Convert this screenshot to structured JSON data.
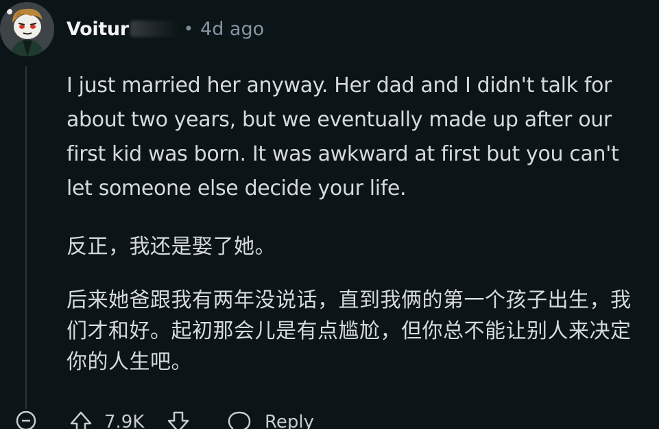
{
  "comment": {
    "author": "Voitur",
    "separator": "•",
    "timestamp": "4d ago",
    "paragraphs_en": [
      "I just married her anyway. Her dad and I didn't talk for about two years, but we eventually made up after our first kid was born. It was awkward at first but you can't let someone else decide your life."
    ],
    "paragraphs_zh": [
      "反正，我还是娶了她。",
      "后来她爸跟我有两年没说话，直到我俩的第一个孩子出生，我们才和好。起初那会儿是有点尴尬，但你总不能让别人来决定你的人生吧。"
    ]
  },
  "actions": {
    "upvote_count": "7.9K",
    "reply_label": "Reply"
  },
  "icons": {
    "avatar": "avatar-icon",
    "collapse": "collapse-icon",
    "upvote": "upvote-icon",
    "downvote": "downvote-icon",
    "reply": "reply-icon"
  },
  "colors": {
    "background": "#0b1416",
    "text": "#d7dadc",
    "muted": "#8796a4"
  }
}
